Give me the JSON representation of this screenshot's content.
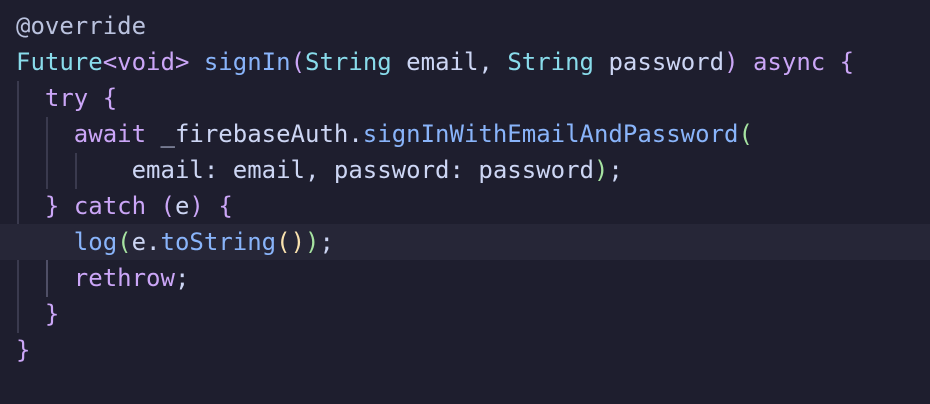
{
  "editor": {
    "lines": [
      {
        "tokens": [
          {
            "text": "@override",
            "kind": "annotation"
          }
        ]
      },
      {
        "tokens": [
          {
            "text": "Future",
            "kind": "type"
          },
          {
            "text": "<",
            "kind": "keyword"
          },
          {
            "text": "void",
            "kind": "keyword"
          },
          {
            "text": ">",
            "kind": "keyword"
          },
          {
            "text": " ",
            "kind": "plain"
          },
          {
            "text": "signIn",
            "kind": "function"
          },
          {
            "text": "(",
            "kind": "keyword"
          },
          {
            "text": "String",
            "kind": "type"
          },
          {
            "text": " email, ",
            "kind": "plain"
          },
          {
            "text": "String",
            "kind": "type"
          },
          {
            "text": " password",
            "kind": "plain"
          },
          {
            "text": ")",
            "kind": "keyword"
          },
          {
            "text": " ",
            "kind": "plain"
          },
          {
            "text": "async",
            "kind": "keyword"
          },
          {
            "text": " ",
            "kind": "plain"
          },
          {
            "text": "{",
            "kind": "keyword"
          }
        ]
      },
      {
        "tokens": [
          {
            "text": "  ",
            "kind": "plain"
          },
          {
            "text": "try",
            "kind": "keyword"
          },
          {
            "text": " ",
            "kind": "plain"
          },
          {
            "text": "{",
            "kind": "keyword"
          }
        ]
      },
      {
        "tokens": [
          {
            "text": "    ",
            "kind": "plain"
          },
          {
            "text": "await",
            "kind": "keyword"
          },
          {
            "text": " _firebaseAuth.",
            "kind": "plain"
          },
          {
            "text": "signInWithEmailAndPassword",
            "kind": "function"
          },
          {
            "text": "(",
            "kind": "bracket2"
          }
        ]
      },
      {
        "tokens": [
          {
            "text": "        email: email, password: password",
            "kind": "plain"
          },
          {
            "text": ")",
            "kind": "bracket2"
          },
          {
            "text": ";",
            "kind": "plain"
          }
        ]
      },
      {
        "tokens": [
          {
            "text": "  ",
            "kind": "plain"
          },
          {
            "text": "}",
            "kind": "keyword"
          },
          {
            "text": " ",
            "kind": "plain"
          },
          {
            "text": "catch",
            "kind": "keyword"
          },
          {
            "text": " ",
            "kind": "plain"
          },
          {
            "text": "(",
            "kind": "keyword"
          },
          {
            "text": "e",
            "kind": "plain"
          },
          {
            "text": ")",
            "kind": "keyword"
          },
          {
            "text": " ",
            "kind": "plain"
          },
          {
            "text": "{",
            "kind": "keyword"
          }
        ]
      },
      {
        "tokens": [
          {
            "text": "    ",
            "kind": "plain"
          },
          {
            "text": "log",
            "kind": "function"
          },
          {
            "text": "(",
            "kind": "bracket2"
          },
          {
            "text": "e.",
            "kind": "plain"
          },
          {
            "text": "toString",
            "kind": "function"
          },
          {
            "text": "(",
            "kind": "bracket1"
          },
          {
            "text": ")",
            "kind": "bracket1"
          },
          {
            "text": ")",
            "kind": "bracket2"
          },
          {
            "text": ";",
            "kind": "plain"
          }
        ]
      },
      {
        "tokens": [
          {
            "text": "    ",
            "kind": "plain"
          },
          {
            "text": "rethrow",
            "kind": "keyword"
          },
          {
            "text": ";",
            "kind": "plain"
          }
        ]
      },
      {
        "tokens": [
          {
            "text": "  ",
            "kind": "plain"
          },
          {
            "text": "}",
            "kind": "keyword"
          }
        ]
      },
      {
        "tokens": [
          {
            "text": "}",
            "kind": "keyword"
          }
        ]
      }
    ],
    "current_line_index": 6,
    "colors": {
      "background": "#1e1e2e",
      "current_line": "#262637",
      "annotation": "#bac2de",
      "type": "#89dceb",
      "keyword": "#cba6f7",
      "function": "#89b4fa",
      "plain": "#cdd6f4",
      "bracket1": "#f9e2af",
      "bracket2": "#a6e3a1"
    }
  }
}
